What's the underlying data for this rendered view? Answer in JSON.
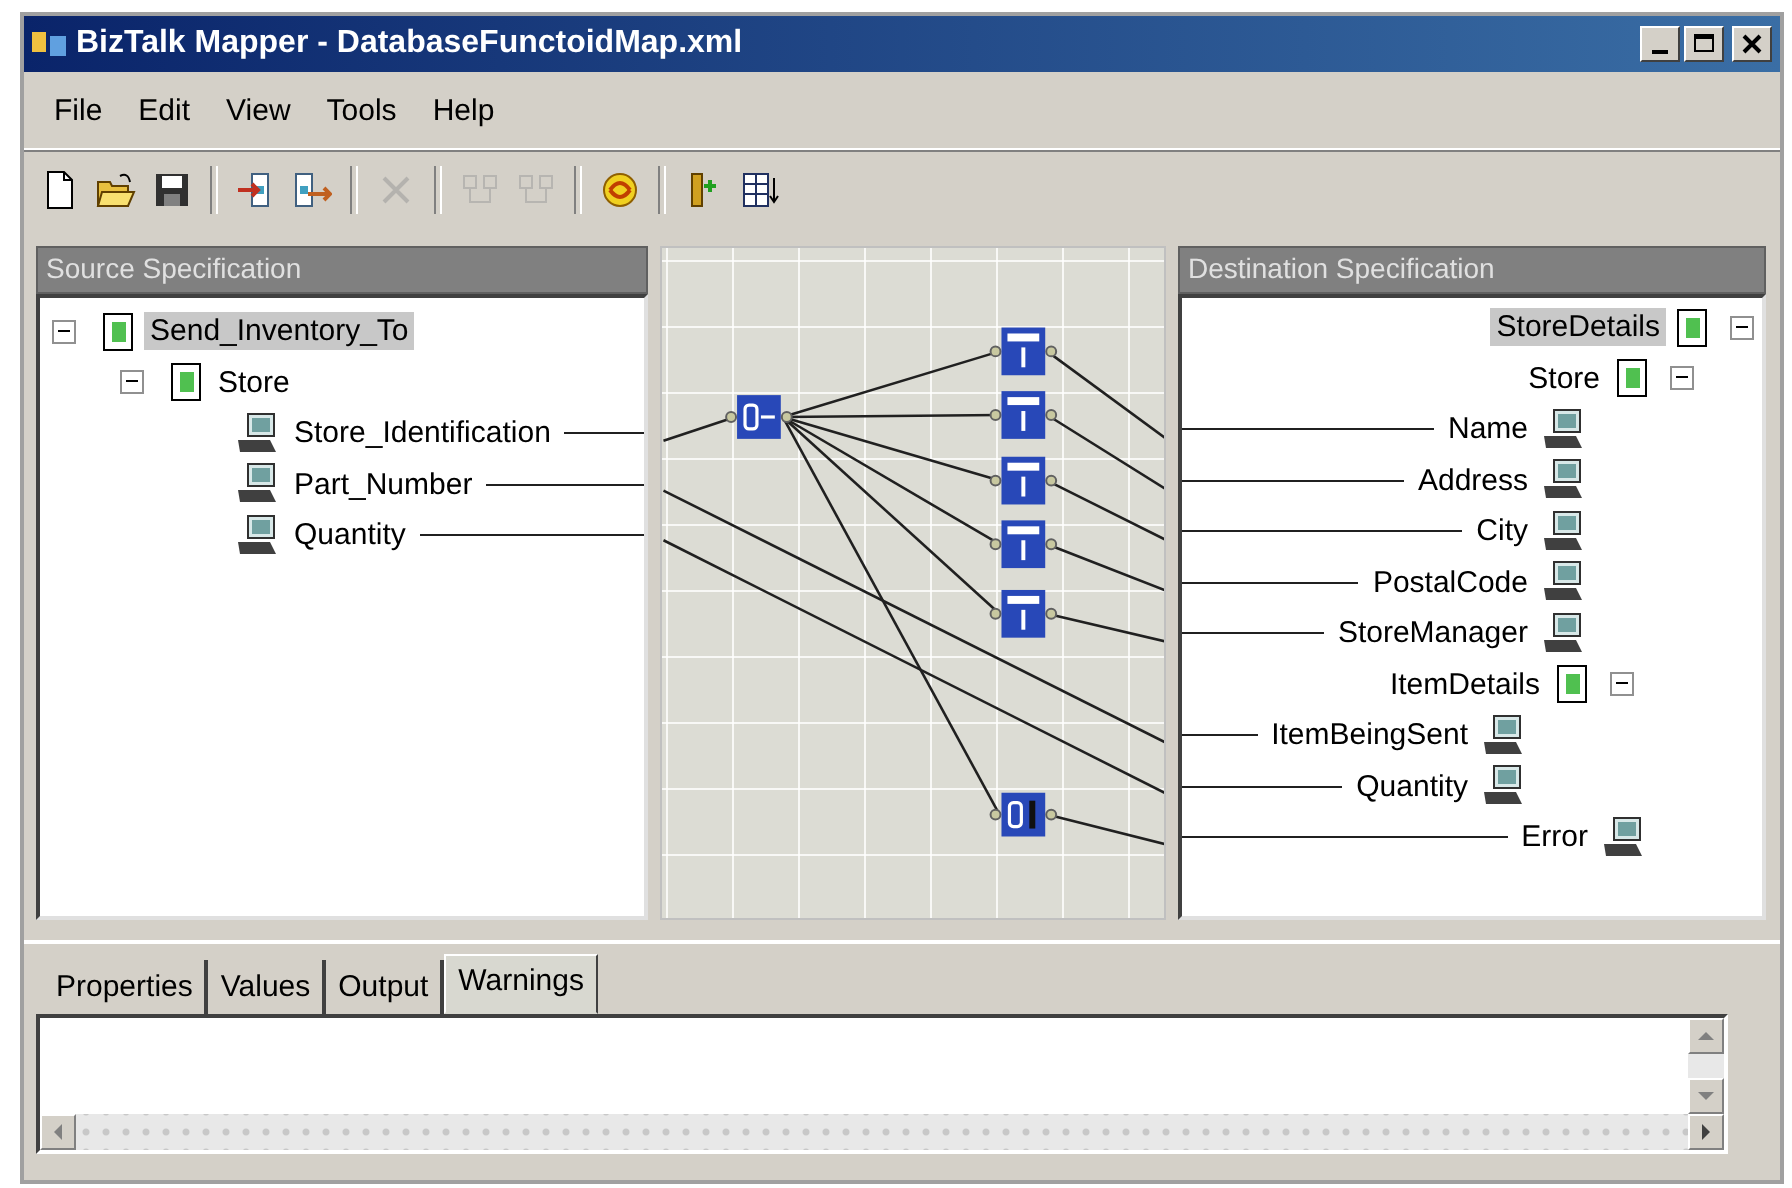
{
  "window": {
    "title": "BizTalk Mapper - DatabaseFunctoidMap.xml"
  },
  "menu": [
    {
      "label": "File"
    },
    {
      "label": "Edit"
    },
    {
      "label": "View"
    },
    {
      "label": "Tools"
    },
    {
      "label": "Help"
    }
  ],
  "toolbar": [
    [
      {
        "kind": "new",
        "disabled": false
      },
      {
        "kind": "open",
        "disabled": false
      },
      {
        "kind": "save",
        "disabled": false
      }
    ],
    [
      {
        "kind": "import",
        "disabled": false
      },
      {
        "kind": "export",
        "disabled": false
      }
    ],
    [
      {
        "kind": "delete",
        "disabled": true
      }
    ],
    [
      {
        "kind": "link-left",
        "disabled": true
      },
      {
        "kind": "link-right",
        "disabled": true
      }
    ],
    [
      {
        "kind": "compile",
        "disabled": false
      }
    ],
    [
      {
        "kind": "test",
        "disabled": false
      },
      {
        "kind": "table",
        "disabled": false
      }
    ]
  ],
  "source": {
    "title": "Source Specification",
    "tree": [
      {
        "label": "Send_Inventory_To",
        "kind": "record",
        "selected": true,
        "expanded": true,
        "children": [
          {
            "label": "Store",
            "kind": "record",
            "selected": false,
            "expanded": true,
            "children": [
              {
                "label": "Store_Identification",
                "kind": "field",
                "selected": false,
                "linked": true
              },
              {
                "label": "Part_Number",
                "kind": "field",
                "selected": false,
                "linked": true
              },
              {
                "label": "Quantity",
                "kind": "field",
                "selected": false,
                "linked": true
              }
            ]
          }
        ]
      }
    ]
  },
  "map": {
    "functoids": [
      {
        "kind": "database"
      },
      {
        "kind": "extractor"
      },
      {
        "kind": "extractor"
      },
      {
        "kind": "extractor"
      },
      {
        "kind": "extractor"
      },
      {
        "kind": "extractor"
      },
      {
        "kind": "error"
      }
    ]
  },
  "destination": {
    "title": "Destination Specification",
    "tree": [
      {
        "label": "StoreDetails",
        "kind": "record",
        "selected": true,
        "expanded": true,
        "children": [
          {
            "label": "Store",
            "kind": "record",
            "selected": false,
            "expanded": true,
            "children": [
              {
                "label": "Name",
                "kind": "field",
                "selected": false,
                "linked": true
              },
              {
                "label": "Address",
                "kind": "field",
                "selected": false,
                "linked": true
              },
              {
                "label": "City",
                "kind": "field",
                "selected": false,
                "linked": true
              },
              {
                "label": "PostalCode",
                "kind": "field",
                "selected": false,
                "linked": true
              },
              {
                "label": "StoreManager",
                "kind": "field",
                "selected": false,
                "linked": true
              },
              {
                "label": "ItemDetails",
                "kind": "record",
                "selected": false,
                "expanded": true,
                "children": [
                  {
                    "label": "ItemBeingSent",
                    "kind": "field",
                    "selected": false,
                    "linked": true
                  },
                  {
                    "label": "Quantity",
                    "kind": "field",
                    "selected": false,
                    "linked": true
                  }
                ]
              }
            ]
          },
          {
            "label": "Error",
            "kind": "field",
            "selected": false,
            "linked": true
          }
        ]
      }
    ]
  },
  "output": {
    "tabs": [
      {
        "label": "Properties",
        "selected": false
      },
      {
        "label": "Values",
        "selected": false
      },
      {
        "label": "Output",
        "selected": false
      },
      {
        "label": "Warnings",
        "selected": true
      }
    ]
  }
}
